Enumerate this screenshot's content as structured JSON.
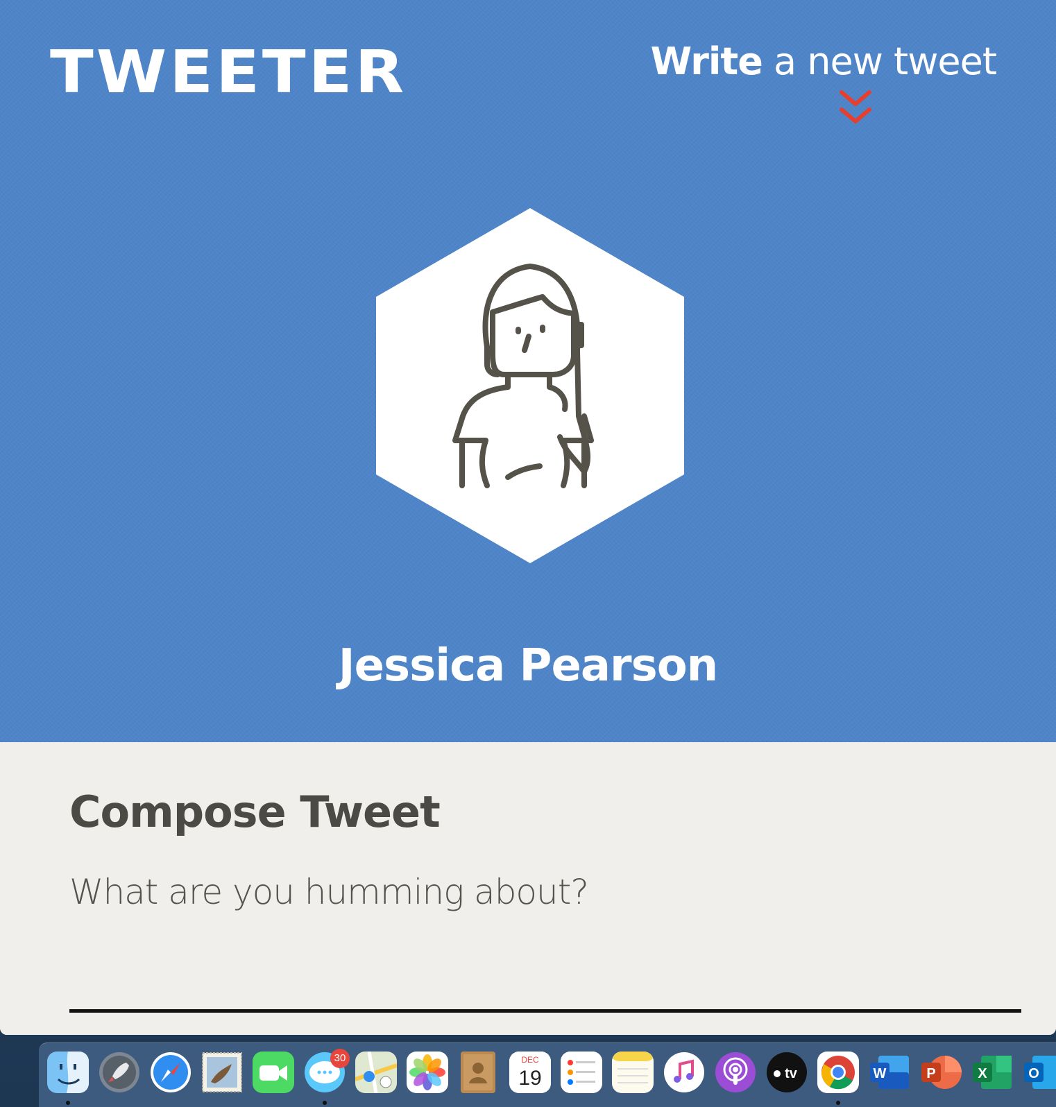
{
  "app": {
    "logo": "TWEETER"
  },
  "header": {
    "write_strong": "Write",
    "write_rest": " a new tweet",
    "chevron_icon": "double-chevron-down-icon",
    "chevron_color": "#e53f2f"
  },
  "profile": {
    "avatar_icon": "woman-avatar-icon",
    "name": "Jessica Pearson"
  },
  "compose": {
    "title": "Compose Tweet",
    "placeholder": "What are you humming about?",
    "value": ""
  },
  "colors": {
    "hero_blue": "#4e84c8",
    "panel_bg": "#f1efeb",
    "text_dark": "#4b4a45"
  },
  "dock": {
    "items": [
      {
        "name": "finder",
        "icon": "finder-icon",
        "running": true
      },
      {
        "name": "launchpad",
        "icon": "rocket-icon",
        "running": false
      },
      {
        "name": "safari",
        "icon": "compass-icon",
        "running": false
      },
      {
        "name": "mail",
        "icon": "stamp-icon",
        "running": false
      },
      {
        "name": "facetime",
        "icon": "video-camera-icon",
        "running": false
      },
      {
        "name": "messages",
        "icon": "chat-bubble-icon",
        "running": true,
        "badge": "30"
      },
      {
        "name": "maps",
        "icon": "map-icon",
        "running": false
      },
      {
        "name": "photos",
        "icon": "flower-icon",
        "running": false
      },
      {
        "name": "contacts",
        "icon": "address-book-icon",
        "running": false
      },
      {
        "name": "calendar",
        "icon": "calendar-icon",
        "running": false,
        "month": "DEC",
        "day": "19"
      },
      {
        "name": "reminders",
        "icon": "checklist-icon",
        "running": false
      },
      {
        "name": "notes",
        "icon": "notepad-icon",
        "running": false
      },
      {
        "name": "music",
        "icon": "music-note-icon",
        "running": false
      },
      {
        "name": "podcasts",
        "icon": "podcast-icon",
        "running": false
      },
      {
        "name": "tv",
        "icon": "tv-icon",
        "running": false,
        "label": "tv"
      },
      {
        "name": "chrome",
        "icon": "chrome-icon",
        "running": true
      },
      {
        "name": "word",
        "icon": "word-icon",
        "running": false,
        "letter": "W"
      },
      {
        "name": "powerpoint",
        "icon": "powerpoint-icon",
        "running": false,
        "letter": "P"
      },
      {
        "name": "excel",
        "icon": "excel-icon",
        "running": false,
        "letter": "X"
      },
      {
        "name": "outlook",
        "icon": "outlook-icon",
        "running": false,
        "letter": "O"
      }
    ]
  }
}
